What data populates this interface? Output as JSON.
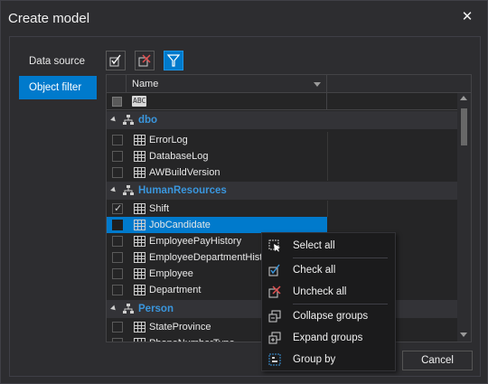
{
  "window": {
    "title": "Create model",
    "close_glyph": "✕"
  },
  "nav": {
    "items": [
      {
        "label": "Data source"
      },
      {
        "label": "Object filter"
      }
    ]
  },
  "toolbar": {
    "icons": [
      "check-all-icon",
      "uncheck-all-icon",
      "filter-icon"
    ]
  },
  "grid": {
    "column_name": "Name",
    "filter_placeholder_icon": "ABC",
    "groups": [
      {
        "name": "dbo",
        "rows": [
          {
            "label": "ErrorLog",
            "checked": false
          },
          {
            "label": "DatabaseLog",
            "checked": false
          },
          {
            "label": "AWBuildVersion",
            "checked": false
          }
        ]
      },
      {
        "name": "HumanResources",
        "rows": [
          {
            "label": "Shift",
            "checked": true
          },
          {
            "label": "JobCandidate",
            "checked": false,
            "selected": true
          },
          {
            "label": "EmployeePayHistory",
            "checked": false
          },
          {
            "label": "EmployeeDepartmentHistory",
            "checked": false
          },
          {
            "label": "Employee",
            "checked": false
          },
          {
            "label": "Department",
            "checked": false
          }
        ]
      },
      {
        "name": "Person",
        "rows": [
          {
            "label": "StateProvince",
            "checked": false
          },
          {
            "label": "PhoneNumberType",
            "checked": false
          }
        ]
      }
    ]
  },
  "context_menu": {
    "items": [
      {
        "label": "Select all",
        "icon": "select-all-icon"
      },
      {
        "label": "Check all",
        "icon": "check-all-icon"
      },
      {
        "label": "Uncheck all",
        "icon": "uncheck-all-icon"
      },
      {
        "label": "Collapse groups",
        "icon": "collapse-groups-icon"
      },
      {
        "label": "Expand groups",
        "icon": "expand-groups-icon"
      },
      {
        "label": "Group by",
        "icon": "group-by-icon"
      }
    ]
  },
  "footer": {
    "cancel_label": "Cancel"
  },
  "colors": {
    "accent": "#007acc",
    "group_text": "#3a96dd",
    "background": "#2d2d30"
  }
}
